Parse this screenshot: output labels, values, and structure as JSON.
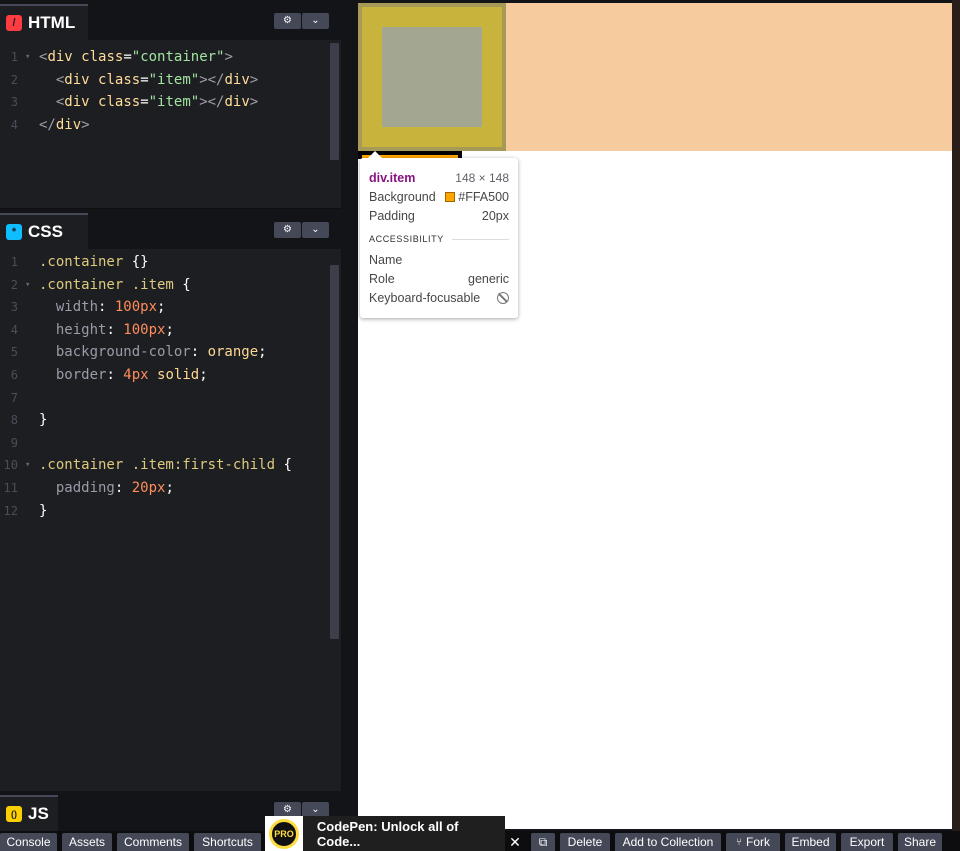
{
  "panels": {
    "html": {
      "title": "HTML",
      "icon": "/",
      "lines": [
        {
          "n": "1",
          "fold": true,
          "code": [
            {
              "c": "tag",
              "t": "<"
            },
            {
              "c": "tname",
              "t": "div"
            },
            {
              "c": "punc",
              "t": " "
            },
            {
              "c": "attr",
              "t": "class"
            },
            {
              "c": "punc",
              "t": "="
            },
            {
              "c": "str",
              "t": "\"container\""
            },
            {
              "c": "tag",
              "t": ">"
            }
          ]
        },
        {
          "n": "2",
          "fold": false,
          "code": [
            {
              "c": "punc",
              "t": "  "
            },
            {
              "c": "tag",
              "t": "<"
            },
            {
              "c": "tname",
              "t": "div"
            },
            {
              "c": "punc",
              "t": " "
            },
            {
              "c": "attr",
              "t": "class"
            },
            {
              "c": "punc",
              "t": "="
            },
            {
              "c": "str",
              "t": "\"item\""
            },
            {
              "c": "tag",
              "t": "></"
            },
            {
              "c": "tname",
              "t": "div"
            },
            {
              "c": "tag",
              "t": ">"
            }
          ]
        },
        {
          "n": "3",
          "fold": false,
          "code": [
            {
              "c": "punc",
              "t": "  "
            },
            {
              "c": "tag",
              "t": "<"
            },
            {
              "c": "tname",
              "t": "div"
            },
            {
              "c": "punc",
              "t": " "
            },
            {
              "c": "attr",
              "t": "class"
            },
            {
              "c": "punc",
              "t": "="
            },
            {
              "c": "str",
              "t": "\"item\""
            },
            {
              "c": "tag",
              "t": "></"
            },
            {
              "c": "tname",
              "t": "div"
            },
            {
              "c": "tag",
              "t": ">"
            }
          ]
        },
        {
          "n": "4",
          "fold": false,
          "code": [
            {
              "c": "tag",
              "t": "</"
            },
            {
              "c": "tname",
              "t": "div"
            },
            {
              "c": "tag",
              "t": ">"
            }
          ]
        }
      ]
    },
    "css": {
      "title": "CSS",
      "icon": "*",
      "lines": [
        {
          "n": "1",
          "fold": false,
          "code": [
            {
              "c": "sel",
              "t": ".container"
            },
            {
              "c": "punc",
              "t": " {}"
            }
          ]
        },
        {
          "n": "2",
          "fold": true,
          "code": [
            {
              "c": "sel",
              "t": ".container .item"
            },
            {
              "c": "punc",
              "t": " {"
            }
          ]
        },
        {
          "n": "3",
          "fold": false,
          "code": [
            {
              "c": "punc",
              "t": "  "
            },
            {
              "c": "prop",
              "t": "width"
            },
            {
              "c": "punc",
              "t": ": "
            },
            {
              "c": "num",
              "t": "100px"
            },
            {
              "c": "punc",
              "t": ";"
            }
          ]
        },
        {
          "n": "4",
          "fold": false,
          "code": [
            {
              "c": "punc",
              "t": "  "
            },
            {
              "c": "prop",
              "t": "height"
            },
            {
              "c": "punc",
              "t": ": "
            },
            {
              "c": "num",
              "t": "100px"
            },
            {
              "c": "punc",
              "t": ";"
            }
          ]
        },
        {
          "n": "5",
          "fold": false,
          "code": [
            {
              "c": "punc",
              "t": "  "
            },
            {
              "c": "prop",
              "t": "background-color"
            },
            {
              "c": "punc",
              "t": ": "
            },
            {
              "c": "val",
              "t": "orange"
            },
            {
              "c": "punc",
              "t": ";"
            }
          ]
        },
        {
          "n": "6",
          "fold": false,
          "code": [
            {
              "c": "punc",
              "t": "  "
            },
            {
              "c": "prop",
              "t": "border"
            },
            {
              "c": "punc",
              "t": ": "
            },
            {
              "c": "num",
              "t": "4px"
            },
            {
              "c": "punc",
              "t": " "
            },
            {
              "c": "val",
              "t": "solid"
            },
            {
              "c": "punc",
              "t": ";"
            }
          ]
        },
        {
          "n": "7",
          "fold": false,
          "code": []
        },
        {
          "n": "8",
          "fold": false,
          "code": [
            {
              "c": "punc",
              "t": "}"
            }
          ]
        },
        {
          "n": "9",
          "fold": false,
          "code": []
        },
        {
          "n": "10",
          "fold": true,
          "code": [
            {
              "c": "sel",
              "t": ".container .item:first-child"
            },
            {
              "c": "punc",
              "t": " {"
            }
          ]
        },
        {
          "n": "11",
          "fold": false,
          "code": [
            {
              "c": "punc",
              "t": "  "
            },
            {
              "c": "prop",
              "t": "padding"
            },
            {
              "c": "punc",
              "t": ": "
            },
            {
              "c": "num",
              "t": "20px"
            },
            {
              "c": "punc",
              "t": ";"
            }
          ]
        },
        {
          "n": "12",
          "fold": false,
          "code": [
            {
              "c": "punc",
              "t": "}"
            }
          ]
        }
      ]
    },
    "js": {
      "title": "JS",
      "icon": "()"
    }
  },
  "tooltip": {
    "element": "div.item",
    "dimensions": "148 × 148",
    "background_label": "Background",
    "background_value": "#FFA500",
    "padding_label": "Padding",
    "padding_value": "20px",
    "section": "ACCESSIBILITY",
    "name_label": "Name",
    "name_value": "",
    "role_label": "Role",
    "role_value": "generic",
    "focusable_label": "Keyboard-focusable"
  },
  "bottom_bar": {
    "left_buttons": [
      "Console",
      "Assets",
      "Comments",
      "Shortcuts"
    ],
    "promo_badge": "PRO",
    "promo_text": "CodePen: Unlock all of Code...",
    "right_buttons": [
      "Delete",
      "Add to Collection",
      "Fork",
      "Embed",
      "Export",
      "Share"
    ]
  },
  "colors": {
    "editor_bg": "#1d1e22",
    "container_bg": "#f6cc9f",
    "item_bg": "#ffa500"
  }
}
